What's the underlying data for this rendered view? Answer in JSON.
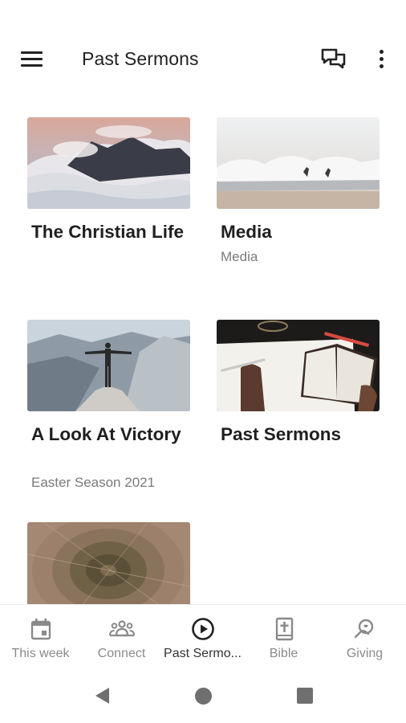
{
  "appbar": {
    "title": "Past Sermons",
    "menu_icon": "hamburger-menu-icon",
    "chat_icon": "chat-bubbles-icon",
    "more_icon": "more-vertical-icon"
  },
  "cards": [
    {
      "title": "The Christian Life",
      "subtitle": "",
      "image": "mountain-clouds-sunset"
    },
    {
      "title": "Media",
      "subtitle": "Media",
      "image": "ocean-waves-surfers"
    },
    {
      "title": "A Look At Victory",
      "subtitle": "Easter Season 2021",
      "image": "man-on-cliff-valley"
    },
    {
      "title": "Past Sermons",
      "subtitle": "",
      "image": "bible-writing-desk"
    },
    {
      "title": "",
      "subtitle": "",
      "image": "tree-rings-texture"
    }
  ],
  "bottom_nav": [
    {
      "label": "This week",
      "icon": "calendar-icon",
      "active": false
    },
    {
      "label": "Connect",
      "icon": "group-people-icon",
      "active": false
    },
    {
      "label": "Past Sermo...",
      "icon": "play-circle-icon",
      "active": true
    },
    {
      "label": "Bible",
      "icon": "bible-book-icon",
      "active": false
    },
    {
      "label": "Giving",
      "icon": "giving-hand-icon",
      "active": false
    }
  ],
  "colors": {
    "text_primary": "#1f1f1f",
    "text_secondary": "#7a7a7a",
    "nav_inactive": "#8a8a8a",
    "nav_active": "#333333"
  }
}
